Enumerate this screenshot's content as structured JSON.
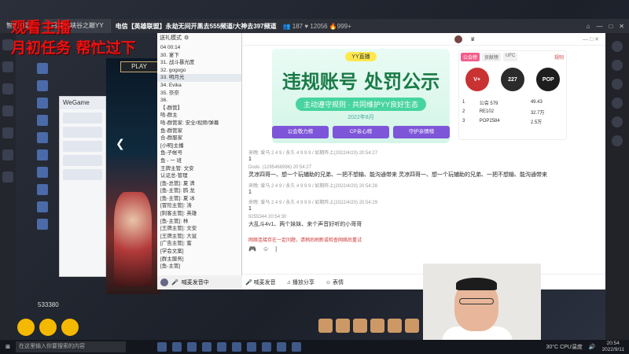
{
  "overlay": {
    "line1": "观看主播",
    "line2": "月初任务 帮忙过下"
  },
  "topbar": {
    "tab1": "智能拖跟机",
    "tab2": "召唤师峡谷之巅YY",
    "room_title": "电信【英雄联盟】永劫无间开黑去555频道/大神去397频道",
    "viewers": "187",
    "fans": "12056",
    "hot": "999+"
  },
  "game": {
    "play_label": "PLAY"
  },
  "wegame": {
    "title": "WeGame",
    "items": [
      "",
      "",
      "",
      "",
      ""
    ]
  },
  "yy": {
    "mode": "送礼模式",
    "rows": [
      "04 00:14",
      "30. 宴下",
      "31. 战斗暴光度",
      "32. gogogo",
      "33. 明月光",
      "34. Evika",
      "35. 奈奈",
      "36. ",
      "【-群管】",
      "哈-群主",
      "哈-群管家: 安全/视频/弹幕",
      "鱼-群管家",
      "合-群服家",
      "[小明]主播",
      "鱼-子帐号",
      "鱼 - 一 班",
      "王牌主管: 文安",
      "认证总-管理",
      "[鱼-总管]: 夏 清",
      "[鱼-主管]: 鸥 龙",
      "[鱼-主管]: 夏 冰",
      "[冒险主管]: 涛",
      "[刺客主管]: 英雄",
      "[鱼-主管]: 林",
      "[王牌主管]: 文安",
      "[王牌主管]: 大鼠",
      "[广告主管]: 蜜",
      "[学会文案]",
      "[群主服务]",
      "[鱼-主管]"
    ],
    "bottom_label": "喊麦发音中"
  },
  "banner": {
    "logo": "YY直播",
    "headline": "违规账号 处罚公示",
    "slogan": "主动遵守规则 · 共同维护YY良好生态",
    "date": "2022年8月",
    "pill1": "公会敬力榜",
    "pill2": "CP亲心榜",
    "pill3": "守护亲情榜"
  },
  "rank": {
    "tabs": [
      "公会榜",
      "贡献榜",
      "UFC"
    ],
    "rule": "规则",
    "badge1": "V+",
    "badge2": "227",
    "badge3": "POP",
    "rows": [
      {
        "rank": "1",
        "name": "公会 579",
        "value": "49.43"
      },
      {
        "rank": "2",
        "name": "RE102",
        "value": "32.7万"
      },
      {
        "rank": "3",
        "name": "POP2584",
        "value": "2.5万"
      }
    ]
  },
  "chat": [
    {
      "meta": "来晚: 爱马 2 4 9 / 永久 4 9 9 9 / 如期昨上(2022/4/20)  20:54:27",
      "body": "1"
    },
    {
      "meta": "Dodo.  (1295466996)  20:54:27",
      "body": "灵凉四哥一、想一个玩辅助的兄弟、一把不想输、能沟通带来 灵凉四哥一、想一个玩辅助的兄弟、一把不想输、能沟通带来"
    },
    {
      "meta": "来晚: 爱马 2 4 9 / 永久 4 9 9 9 / 如期昨上(2022/4/20)  20:54:28",
      "body": "1"
    },
    {
      "meta": "来晚: 爱马 2 4 9 / 永久 4 9 9 9 / 如期昨上(2022/4/20)  20:54:29",
      "body": "1"
    },
    {
      "meta": "9255344  20:54:30",
      "body": "大乱斗4v1、两个妹妹、来个声音好听的小哥哥"
    }
  ],
  "notice": "网络连接存在一定问题，请稍后刷新或检查网络后重试",
  "bottombar": {
    "mic": "喊麦发音",
    "share": "播放分享",
    "mood": "表情"
  },
  "bottom_id": "533380",
  "taskbar": {
    "search": "在这里输入你要搜索的内容",
    "temp": "30°C",
    "cpu": "CPU温度",
    "time": "20:54",
    "date": "2022/9/11"
  }
}
